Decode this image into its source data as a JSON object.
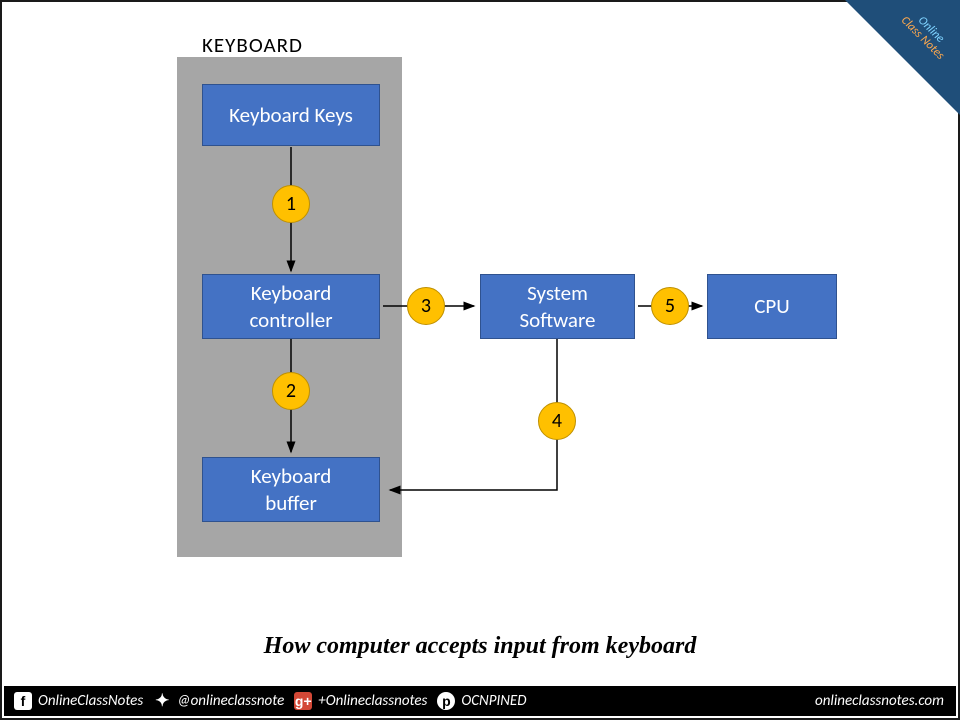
{
  "diagram": {
    "group_label": "KEYBOARD",
    "boxes": {
      "keys": "Keyboard Keys",
      "controller": "Keyboard\ncontroller",
      "buffer": "Keyboard\nbuffer",
      "system": "System\nSoftware",
      "cpu": "CPU"
    },
    "badges": {
      "b1": "1",
      "b2": "2",
      "b3": "3",
      "b4": "4",
      "b5": "5"
    },
    "caption": "How computer accepts input from keyboard"
  },
  "footer": {
    "fb": "OnlineClassNotes",
    "tw": "@onlineclassnote",
    "gp": "+Onlineclassnotes",
    "pn": "OCNPINED",
    "domain": "onlineclassnotes.com"
  },
  "corner": {
    "line1": "Online",
    "line2": "Class Notes"
  }
}
